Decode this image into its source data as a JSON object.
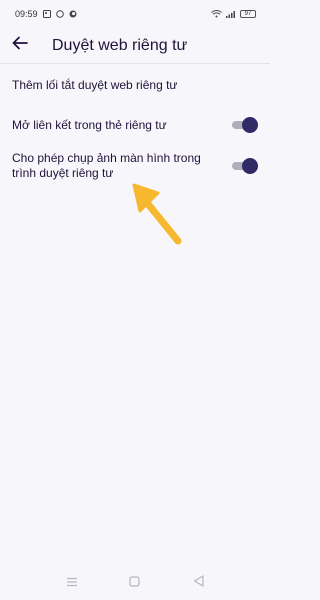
{
  "status_bar": {
    "time": "09:59",
    "battery": "97",
    "icons": [
      "photo-icon",
      "whatsapp-icon",
      "firefox-icon",
      "wifi-icon",
      "signal-icon",
      "battery-icon"
    ]
  },
  "header": {
    "title": "Duyệt web riêng tư",
    "back_icon": "back-arrow-icon"
  },
  "settings": {
    "shortcut_label": "Thêm lối tắt duyệt web riêng tư",
    "open_links_label": "Mở liên kết trong thẻ riêng tư",
    "open_links_enabled": true,
    "screenshot_label": "Cho phép chụp ảnh màn hình trong trình duyệt riêng tư",
    "screenshot_enabled": true
  },
  "colors": {
    "background": "#f7f6fb",
    "text": "#20123a",
    "toggle_thumb": "#312a65",
    "toggle_track": "#b0adbd",
    "annotation_arrow": "#f5b82e"
  },
  "nav_bar": {
    "icons": [
      "menu-icon",
      "home-square-icon",
      "back-triangle-icon"
    ]
  }
}
